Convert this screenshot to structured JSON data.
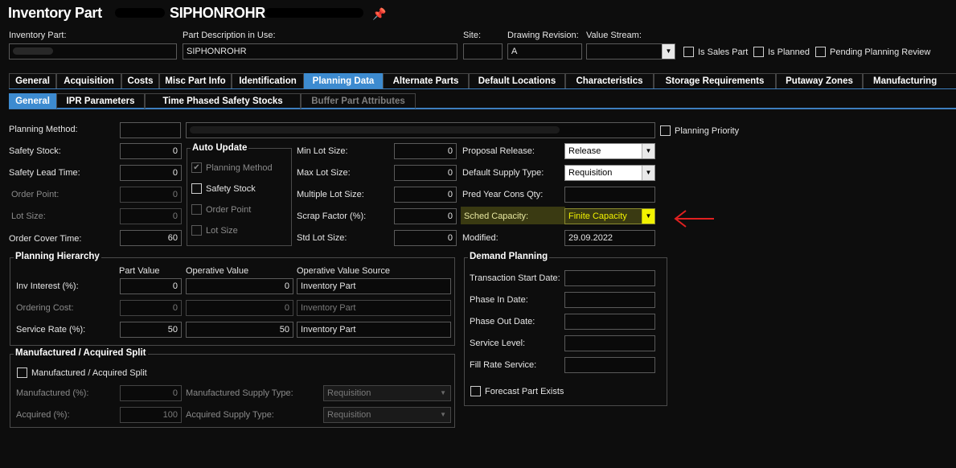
{
  "header": {
    "title": "Inventory Part",
    "part_code": "SIPHONROHR",
    "pin_icon": "pin-icon"
  },
  "top_fields": {
    "inventory_part_label": "Inventory Part:",
    "part_description_label": "Part Description in Use:",
    "part_description_value": "SIPHONROHR",
    "site_label": "Site:",
    "drawing_revision_label": "Drawing Revision:",
    "drawing_revision_value": "A",
    "value_stream_label": "Value Stream:",
    "is_sales_part_label": "Is Sales Part",
    "is_planned_label": "Is Planned",
    "pending_planning_review_label": "Pending Planning Review"
  },
  "main_tabs": [
    "General",
    "Acquisition",
    "Costs",
    "Misc Part Info",
    "Identification",
    "Planning Data",
    "Alternate Parts",
    "Default Locations",
    "Characteristics",
    "Storage Requirements",
    "Putaway Zones",
    "Manufacturing MRO"
  ],
  "sub_tabs": [
    "General",
    "IPR Parameters",
    "Time Phased Safety Stocks",
    "Buffer Part Attributes"
  ],
  "planning": {
    "planning_method_label": "Planning Method:",
    "planning_priority_label": "Planning Priority",
    "safety_stock_label": "Safety Stock:",
    "safety_stock_value": "0",
    "safety_lead_time_label": "Safety Lead Time:",
    "safety_lead_time_value": "0",
    "order_point_label": "Order Point:",
    "order_point_value": "0",
    "lot_size_label": "Lot Size:",
    "lot_size_value": "0",
    "order_cover_time_label": "Order Cover Time:",
    "order_cover_time_value": "60"
  },
  "auto_update": {
    "title": "Auto Update",
    "planning_method": "Planning Method",
    "safety_stock": "Safety Stock",
    "order_point": "Order Point",
    "lot_size": "Lot Size"
  },
  "lot": {
    "min_lot_size_label": "Min Lot Size:",
    "min_lot_size_value": "0",
    "max_lot_size_label": "Max Lot Size:",
    "max_lot_size_value": "0",
    "multiple_lot_size_label": "Multiple Lot Size:",
    "multiple_lot_size_value": "0",
    "scrap_factor_label": "Scrap Factor (%):",
    "scrap_factor_value": "0",
    "std_lot_size_label": "Std Lot Size:",
    "std_lot_size_value": "0"
  },
  "proposal": {
    "proposal_release_label": "Proposal Release:",
    "proposal_release_value": "Release",
    "default_supply_type_label": "Default Supply Type:",
    "default_supply_type_value": "Requisition",
    "pred_year_cons_qty_label": "Pred Year Cons Qty:",
    "sched_capacity_label": "Sched Capacity:",
    "sched_capacity_value": "Finite Capacity",
    "modified_label": "Modified:",
    "modified_value": "29.09.2022"
  },
  "planning_hierarchy": {
    "title": "Planning Hierarchy",
    "col_part_value": "Part Value",
    "col_operative_value": "Operative Value",
    "col_operative_source": "Operative Value Source",
    "rows": [
      {
        "label": "Inv Interest (%):",
        "part": "0",
        "operative": "0",
        "source": "Inventory Part"
      },
      {
        "label": "Ordering Cost:",
        "part": "0",
        "operative": "0",
        "source": "Inventory Part"
      },
      {
        "label": "Service Rate (%):",
        "part": "50",
        "operative": "50",
        "source": "Inventory Part"
      }
    ]
  },
  "split": {
    "title": "Manufactured / Acquired Split",
    "checkbox_label": "Manufactured / Acquired Split",
    "manufactured_label": "Manufactured (%):",
    "manufactured_value": "0",
    "manufactured_supply_label": "Manufactured Supply Type:",
    "manufactured_supply_value": "Requisition",
    "acquired_label": "Acquired (%):",
    "acquired_value": "100",
    "acquired_supply_label": "Acquired Supply Type:",
    "acquired_supply_value": "Requisition"
  },
  "demand_planning": {
    "title": "Demand Planning",
    "transaction_start_date_label": "Transaction Start Date:",
    "phase_in_date_label": "Phase In Date:",
    "phase_out_date_label": "Phase Out Date:",
    "service_level_label": "Service Level:",
    "fill_rate_service_label": "Fill Rate Service:",
    "forecast_part_exists_label": "Forecast Part Exists"
  },
  "colors": {
    "background": "#0d0d0d",
    "active_tab": "#3d8bd0",
    "highlight_field": "#f2f200",
    "annotation_arrow": "#e02020"
  }
}
